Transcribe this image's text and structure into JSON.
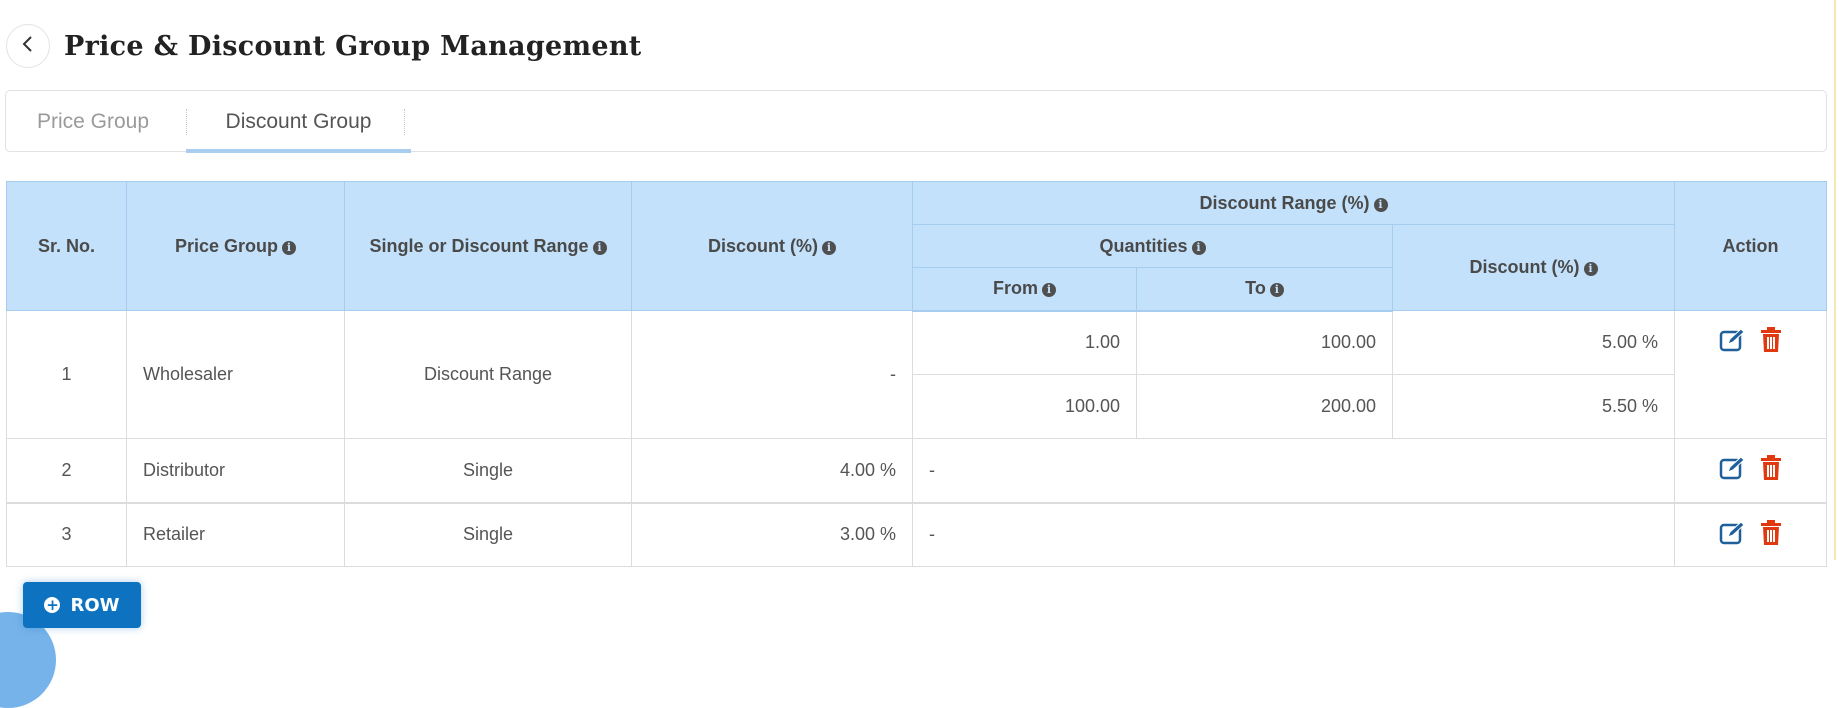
{
  "header": {
    "back_icon": "chevron-left-icon",
    "title": "Price & Discount Group Management"
  },
  "tabs": [
    {
      "label": "Price Group",
      "active": false
    },
    {
      "label": "Discount Group",
      "active": true
    }
  ],
  "table": {
    "headers": {
      "sr_no": "Sr. No.",
      "price_group": "Price Group",
      "single_or_range": "Single or Discount Range",
      "discount": "Discount (%)",
      "discount_range": "Discount Range (%)",
      "quantities": "Quantities",
      "from": "From",
      "to": "To",
      "range_discount": "Discount (%)",
      "action": "Action"
    },
    "info_icon": "info-circle-icon",
    "rows": [
      {
        "sr_no": "1",
        "price_group": "Wholesaler",
        "type": "Discount Range",
        "discount": "-",
        "ranges": [
          {
            "from": "1.00",
            "to": "100.00",
            "discount": "5.00 %"
          },
          {
            "from": "100.00",
            "to": "200.00",
            "discount": "5.50 %"
          }
        ]
      },
      {
        "sr_no": "2",
        "price_group": "Distributor",
        "type": "Single",
        "discount": "4.00 %",
        "range_placeholder": "-"
      },
      {
        "sr_no": "3",
        "price_group": "Retailer",
        "type": "Single",
        "discount": "3.00 %",
        "range_placeholder": "-"
      }
    ],
    "action_icons": [
      "edit-icon",
      "trash-icon"
    ]
  },
  "add_row_button": {
    "label": "ROW",
    "icon": "plus-circle-icon"
  },
  "colors": {
    "header_bg": "#c3e1fa",
    "primary": "#0d72c0",
    "edit": "#1f5f9a",
    "delete": "#e0380f",
    "active_tab_underline": "#a8cdee"
  }
}
